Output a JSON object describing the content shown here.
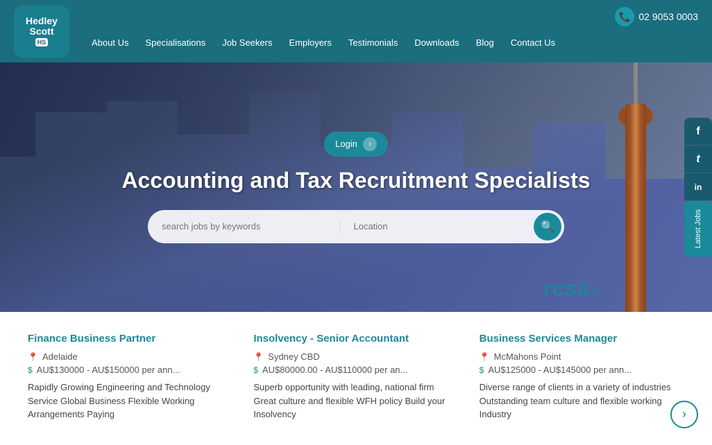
{
  "header": {
    "logo": {
      "line1": "Hedley",
      "line2": "Scott",
      "badge": "HS"
    },
    "phone": "02 9053 0003",
    "nav": [
      {
        "label": "About Us",
        "href": "#"
      },
      {
        "label": "Specialisations",
        "href": "#"
      },
      {
        "label": "Job Seekers",
        "href": "#"
      },
      {
        "label": "Employers",
        "href": "#"
      },
      {
        "label": "Testimonials",
        "href": "#"
      },
      {
        "label": "Downloads",
        "href": "#"
      },
      {
        "label": "Blog",
        "href": "#"
      },
      {
        "label": "Contact Us",
        "href": "#"
      }
    ]
  },
  "hero": {
    "login_label": "Login",
    "title": "Accounting and Tax Recruitment Specialists",
    "search": {
      "keywords_placeholder": "search jobs by keywords",
      "location_placeholder": "Location"
    },
    "rcsa": "rcsa",
    "social": [
      {
        "icon": "f",
        "name": "facebook"
      },
      {
        "icon": "t",
        "name": "twitter"
      },
      {
        "icon": "in",
        "name": "linkedin"
      }
    ],
    "latest_jobs": "Latest Jobs"
  },
  "jobs": [
    {
      "title": "Finance Business Partner",
      "location": "Adelaide",
      "salary": "AU$130000 - AU$150000 per ann...",
      "description": "Rapidly Growing Engineering and Technology Service Global Business Flexible Working Arrangements Paying"
    },
    {
      "title": "Insolvency - Senior Accountant",
      "location": "Sydney CBD",
      "salary": "AU$80000.00 - AU$110000 per an...",
      "description": "Superb opportunity with leading, national firm Great culture and flexible WFH policy Build your Insolvency"
    },
    {
      "title": "Business Services Manager",
      "location": "McMahons Point",
      "salary": "AU$125000 - AU$145000 per ann...",
      "description": "Diverse range of clients in a variety of industries Outstanding team culture and flexible working Industry"
    }
  ]
}
